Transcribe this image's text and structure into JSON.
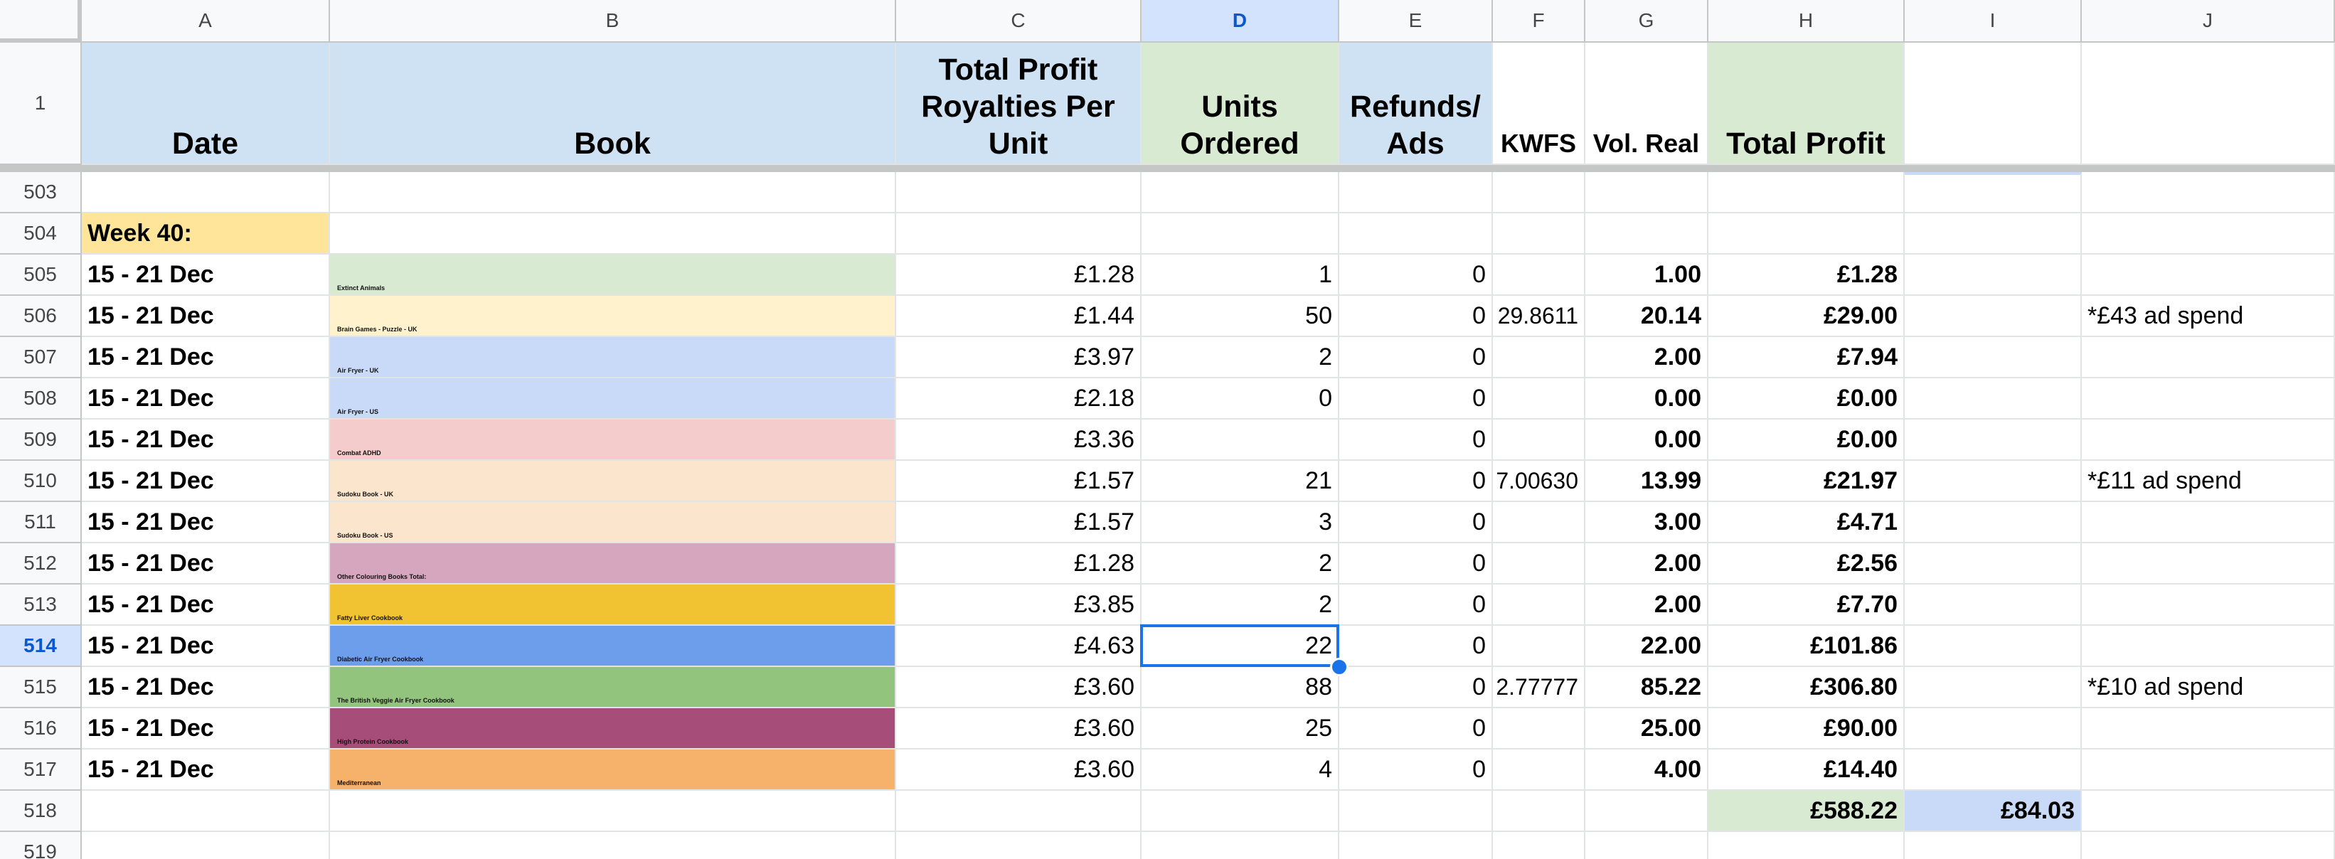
{
  "columns": [
    "A",
    "B",
    "C",
    "D",
    "E",
    "F",
    "G",
    "H",
    "I",
    "J"
  ],
  "selected_column": "D",
  "selected_row": "514",
  "header_row": {
    "row_number": "1",
    "A": "Date",
    "B": "Book",
    "C_line1": "Total Profit",
    "C_line2": "Royalties Per",
    "C_line3": "Unit",
    "D_line1": "Units",
    "D_line2": "Ordered",
    "E_line1": "Refunds/",
    "E_line2": "Ads",
    "F": "KWFS",
    "G": "Vol. Real",
    "H": "Total Profit"
  },
  "colors": {
    "header_blue": "#cfe2f3",
    "header_green": "#d9ead3",
    "week_yellow": "#ffe599",
    "total_green": "#d9ead3",
    "total_blue": "#c9daf8",
    "selection": "#1a73e8"
  },
  "rows": [
    {
      "num": "503"
    },
    {
      "num": "504",
      "A": "Week 40:"
    },
    {
      "num": "505",
      "A": "15 - 21 Dec",
      "B": "Extinct Animals",
      "bcolor": "#d9ead3",
      "C": "£1.28",
      "D": "1",
      "E": "0",
      "F": "",
      "G": "1.00",
      "H": "£1.28",
      "J": ""
    },
    {
      "num": "506",
      "A": "15 - 21 Dec",
      "B": "Brain Games - Puzzle - UK",
      "bcolor": "#fff2cc",
      "C": "£1.44",
      "D": "50",
      "E": "0",
      "F": "29.8611",
      "G": "20.14",
      "H": "£29.00",
      "J": "*£43 ad spend"
    },
    {
      "num": "507",
      "A": "15 - 21 Dec",
      "B": "Air Fryer - UK",
      "bcolor": "#c9daf8",
      "C": "£3.97",
      "D": "2",
      "E": "0",
      "F": "",
      "G": "2.00",
      "H": "£7.94",
      "J": ""
    },
    {
      "num": "508",
      "A": "15 - 21 Dec",
      "B": "Air Fryer - US",
      "bcolor": "#c9daf8",
      "C": "£2.18",
      "D": "0",
      "E": "0",
      "F": "",
      "G": "0.00",
      "H": "£0.00",
      "J": ""
    },
    {
      "num": "509",
      "A": "15 - 21 Dec",
      "B": "Combat ADHD",
      "bcolor": "#f4cccc",
      "C": "£3.36",
      "D": "",
      "E": "0",
      "F": "",
      "G": "0.00",
      "H": "£0.00",
      "J": ""
    },
    {
      "num": "510",
      "A": "15 - 21 Dec",
      "B": "Sudoku Book - UK",
      "bcolor": "#fce5cd",
      "C": "£1.57",
      "D": "21",
      "E": "0",
      "F": "7.00630",
      "G": "13.99",
      "H": "£21.97",
      "J": "*£11 ad spend"
    },
    {
      "num": "511",
      "A": "15 - 21 Dec",
      "B": "Sudoku Book - US",
      "bcolor": "#fce5cd",
      "C": "£1.57",
      "D": "3",
      "E": "0",
      "F": "",
      "G": "3.00",
      "H": "£4.71",
      "J": ""
    },
    {
      "num": "512",
      "A": "15 - 21 Dec",
      "B": "Other Colouring Books Total:",
      "bcolor": "#d5a6bd",
      "C": "£1.28",
      "D": "2",
      "E": "0",
      "F": "",
      "G": "2.00",
      "H": "£2.56",
      "J": ""
    },
    {
      "num": "513",
      "A": "15 - 21 Dec",
      "B": "Fatty Liver Cookbook",
      "bcolor": "#f1c232",
      "C": "£3.85",
      "D": "2",
      "E": "0",
      "F": "",
      "G": "2.00",
      "H": "£7.70",
      "J": ""
    },
    {
      "num": "514",
      "A": "15 - 21 Dec",
      "B": "Diabetic Air Fryer Cookbook",
      "bcolor": "#6d9eeb",
      "C": "£4.63",
      "D": "22",
      "E": "0",
      "F": "",
      "G": "22.00",
      "H": "£101.86",
      "J": ""
    },
    {
      "num": "515",
      "A": "15 - 21 Dec",
      "B": "The British Veggie Air Fryer Cookbook",
      "bcolor": "#93c47d",
      "C": "£3.60",
      "D": "88",
      "E": "0",
      "F": "2.77777",
      "G": "85.22",
      "H": "£306.80",
      "J": "*£10 ad spend"
    },
    {
      "num": "516",
      "A": "15 - 21 Dec",
      "B": "High Protein Cookbook",
      "bcolor": "#a64d79",
      "C": "£3.60",
      "D": "25",
      "E": "0",
      "F": "",
      "G": "25.00",
      "H": "£90.00",
      "J": ""
    },
    {
      "num": "517",
      "A": "15 - 21 Dec",
      "B": "Mediterranean",
      "bcolor": "#f6b26b",
      "C": "£3.60",
      "D": "4",
      "E": "0",
      "F": "",
      "G": "4.00",
      "H": "£14.40",
      "J": ""
    },
    {
      "num": "518",
      "H": "£588.22",
      "I": "£84.03"
    },
    {
      "num": "519"
    }
  ]
}
